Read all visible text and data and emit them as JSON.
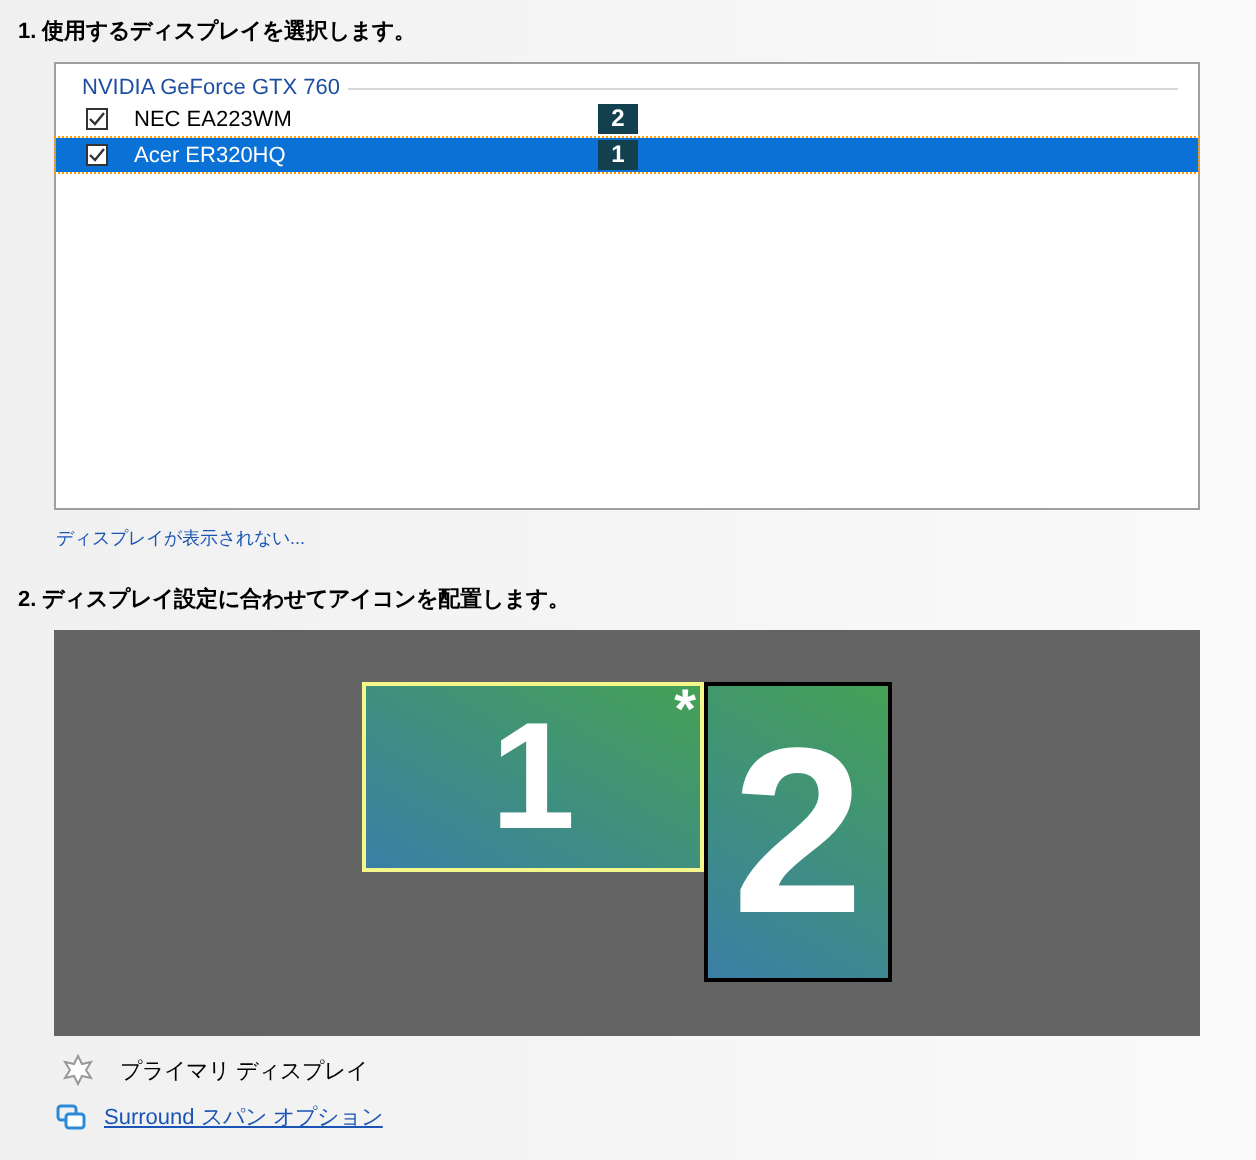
{
  "step1": {
    "heading": "1. 使用するディスプレイを選択します。",
    "gpu": "NVIDIA GeForce GTX 760",
    "displays": [
      {
        "name": "NEC EA223WM",
        "checked": true,
        "selected": false,
        "badge": "2"
      },
      {
        "name": "Acer ER320HQ",
        "checked": true,
        "selected": true,
        "badge": "1"
      }
    ],
    "link": "ディスプレイが表示されない..."
  },
  "step2": {
    "heading": "2. ディスプレイ設定に合わせてアイコンを配置します。",
    "monitors": [
      {
        "label": "1",
        "selected": true,
        "mark": "*",
        "kind": "landscape"
      },
      {
        "label": "2",
        "selected": false,
        "kind": "portrait"
      }
    ],
    "legend": "プライマリ ディスプレイ",
    "surround_link": "Surround スパン オプション"
  }
}
